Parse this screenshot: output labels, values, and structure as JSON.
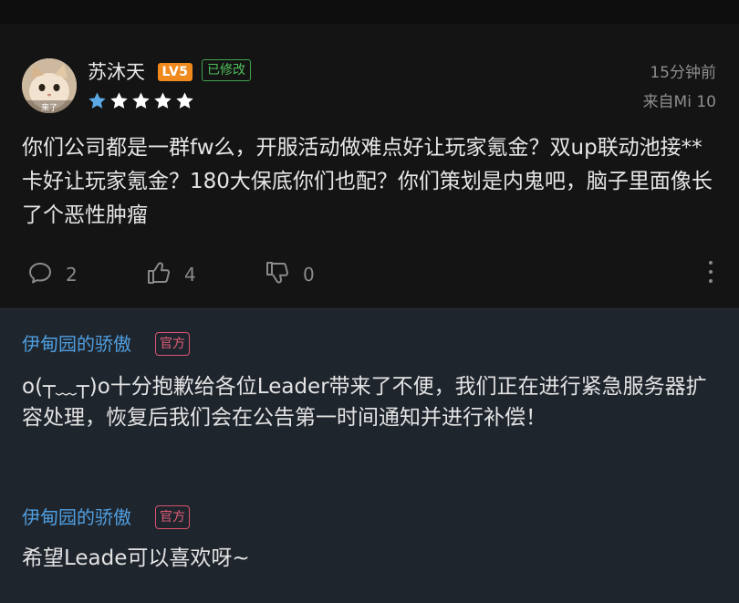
{
  "post": {
    "author": {
      "name": "苏沐天",
      "level": "LV5",
      "edited_tag": "已修改",
      "avatar_caption": "来了",
      "stars_total": 5,
      "stars_highlighted": 1
    },
    "time": "15分钟前",
    "source": "来自Mi 10",
    "content": "你们公司都是一群fw么，开服活动做难点好让玩家氪金？双up联动池接**卡好让玩家氪金？180大保底你们也配？你们策划是内鬼吧，脑子里面像长了个恶性肿瘤",
    "comments_count": "2",
    "likes_count": "4",
    "dislikes_count": "0"
  },
  "replies": [
    {
      "author": "伊甸园的骄傲",
      "tag": "官方",
      "content": "o(┬﹏┬)o十分抱歉给各位Leader带来了不便，我们正在进行紧急服务器扩容处理，恢复后我们会在公告第一时间通知并进行补偿！"
    },
    {
      "author": "伊甸园的骄傲",
      "tag": "官方",
      "content": "希望Leade可以喜欢呀~"
    }
  ],
  "colors": {
    "background": "#141414",
    "reply_background": "#1f252d",
    "level_badge": "#f08a1c",
    "edited_tag": "#4fbf5c",
    "official_author": "#4f9fe0",
    "official_tag": "#e35d78",
    "star_active": "#5aa9e6",
    "star_inactive": "#ffffff"
  },
  "icons": {
    "comment": "comment-icon",
    "like": "thumbs-up-icon",
    "dislike": "thumbs-down-icon",
    "more": "more-vertical-icon"
  }
}
